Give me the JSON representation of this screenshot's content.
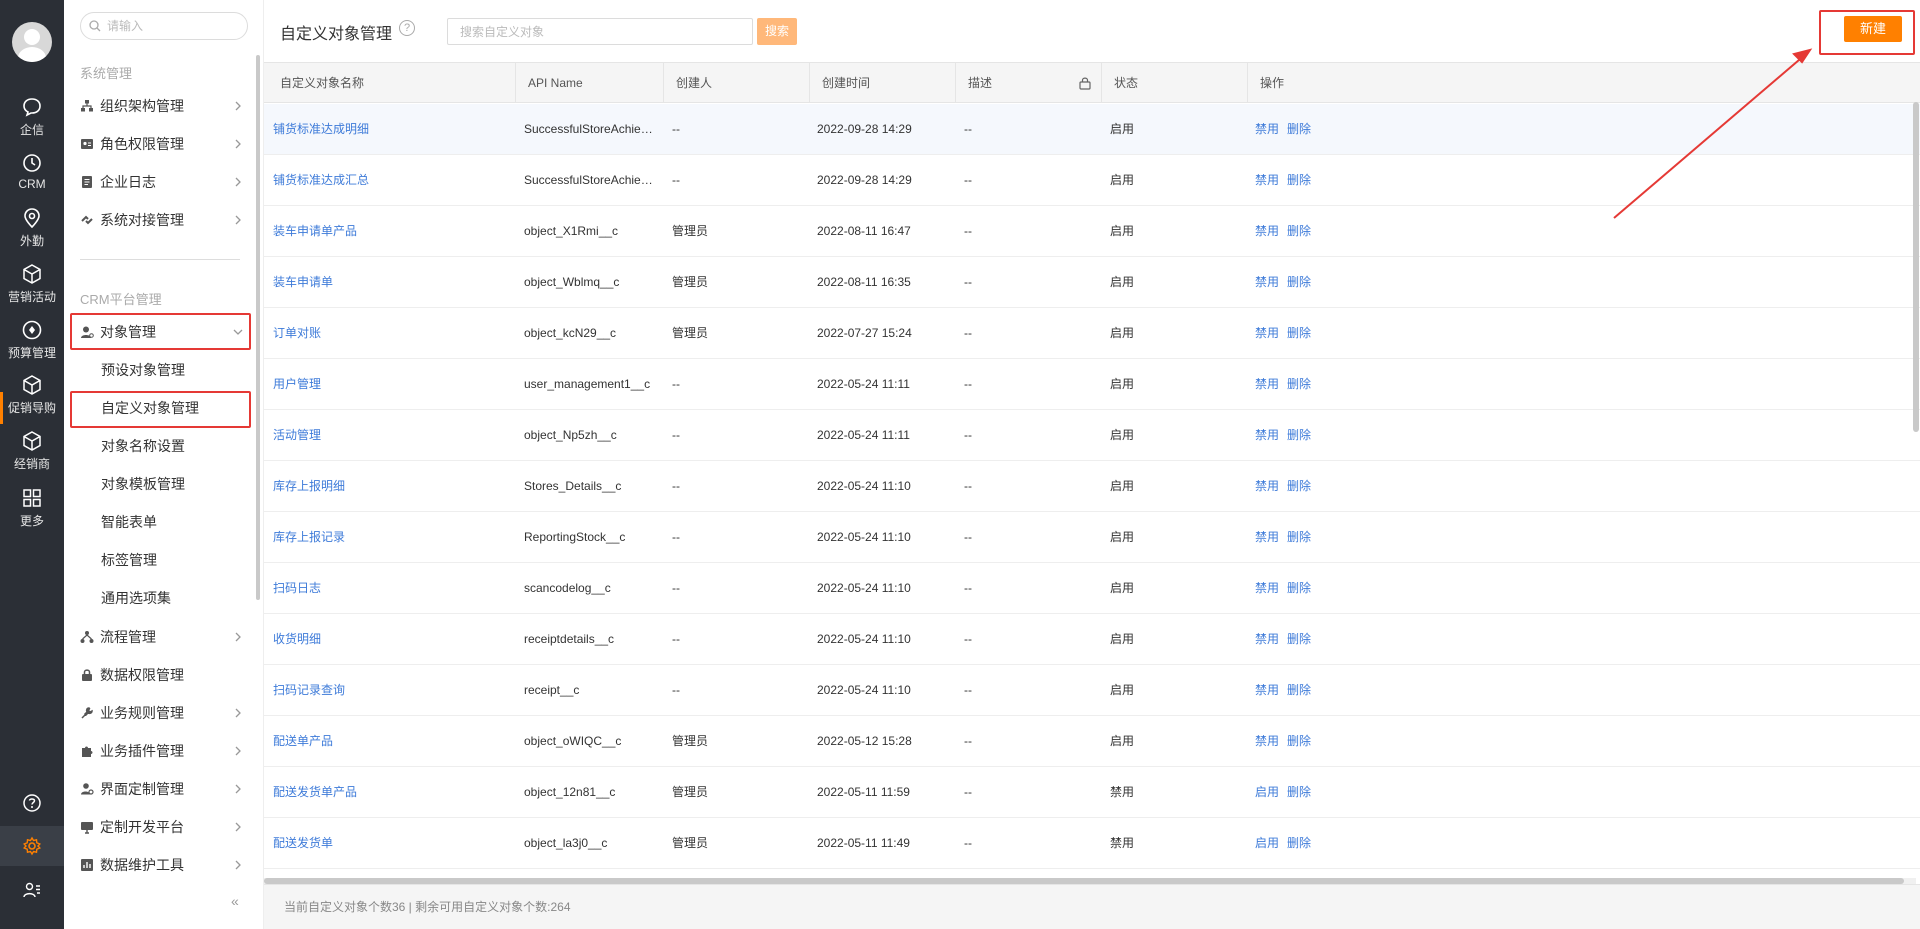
{
  "rail": {
    "items": [
      {
        "label": "企信",
        "icon": "chat-bubble-icon"
      },
      {
        "label": "CRM",
        "icon": "clock-icon"
      },
      {
        "label": "外勤",
        "icon": "location-pin-icon"
      },
      {
        "label": "营销活动",
        "icon": "cube-icon"
      },
      {
        "label": "预算管理",
        "icon": "target-icon"
      },
      {
        "label": "促销导购",
        "icon": "cube-icon"
      },
      {
        "label": "经销商",
        "icon": "cube-icon"
      },
      {
        "label": "更多",
        "icon": "grid-icon"
      }
    ],
    "bottom": [
      "help-icon",
      "settings-icon",
      "user-list-icon"
    ]
  },
  "subnav": {
    "search_placeholder": "请输入",
    "group_system": "系统管理",
    "system_items": [
      "组织架构管理",
      "角色权限管理",
      "企业日志",
      "系统对接管理"
    ],
    "group_crm": "CRM平台管理",
    "object_mgmt": "对象管理",
    "object_sub": [
      "预设对象管理",
      "自定义对象管理",
      "对象名称设置",
      "对象模板管理",
      "智能表单",
      "标签管理",
      "通用选项集"
    ],
    "crm_items": [
      "流程管理",
      "数据权限管理",
      "业务规则管理",
      "业务插件管理",
      "界面定制管理",
      "定制开发平台",
      "数据维护工具"
    ],
    "collapse_label": "«"
  },
  "header": {
    "title": "自定义对象管理",
    "help": "?",
    "search_placeholder": "搜索自定义对象",
    "search_label": "搜索",
    "new_label": "新建"
  },
  "table": {
    "columns": [
      "自定义对象名称",
      "API Name",
      "创建人",
      "创建时间",
      "描述",
      "状态",
      "操作"
    ],
    "rows": [
      {
        "name": "铺货标准达成明细",
        "api": "SuccessfulStoreAchie…",
        "creator": "--",
        "time": "2022-09-28 14:29",
        "desc": "--",
        "status": "启用",
        "op1": "禁用",
        "op2": "删除"
      },
      {
        "name": "铺货标准达成汇总",
        "api": "SuccessfulStoreAchie…",
        "creator": "--",
        "time": "2022-09-28 14:29",
        "desc": "--",
        "status": "启用",
        "op1": "禁用",
        "op2": "删除"
      },
      {
        "name": "装车申请单产品",
        "api": "object_X1Rmi__c",
        "creator": "管理员",
        "time": "2022-08-11 16:47",
        "desc": "--",
        "status": "启用",
        "op1": "禁用",
        "op2": "删除"
      },
      {
        "name": "装车申请单",
        "api": "object_Wblmq__c",
        "creator": "管理员",
        "time": "2022-08-11 16:35",
        "desc": "--",
        "status": "启用",
        "op1": "禁用",
        "op2": "删除"
      },
      {
        "name": "订单对账",
        "api": "object_kcN29__c",
        "creator": "管理员",
        "time": "2022-07-27 15:24",
        "desc": "--",
        "status": "启用",
        "op1": "禁用",
        "op2": "删除"
      },
      {
        "name": "用户管理",
        "api": "user_management1__c",
        "creator": "--",
        "time": "2022-05-24 11:11",
        "desc": "--",
        "status": "启用",
        "op1": "禁用",
        "op2": "删除"
      },
      {
        "name": "活动管理",
        "api": "object_Np5zh__c",
        "creator": "--",
        "time": "2022-05-24 11:11",
        "desc": "--",
        "status": "启用",
        "op1": "禁用",
        "op2": "删除"
      },
      {
        "name": "库存上报明细",
        "api": "Stores_Details__c",
        "creator": "--",
        "time": "2022-05-24 11:10",
        "desc": "--",
        "status": "启用",
        "op1": "禁用",
        "op2": "删除"
      },
      {
        "name": "库存上报记录",
        "api": "ReportingStock__c",
        "creator": "--",
        "time": "2022-05-24 11:10",
        "desc": "--",
        "status": "启用",
        "op1": "禁用",
        "op2": "删除"
      },
      {
        "name": "扫码日志",
        "api": "scancodelog__c",
        "creator": "--",
        "time": "2022-05-24 11:10",
        "desc": "--",
        "status": "启用",
        "op1": "禁用",
        "op2": "删除"
      },
      {
        "name": "收货明细",
        "api": "receiptdetails__c",
        "creator": "--",
        "time": "2022-05-24 11:10",
        "desc": "--",
        "status": "启用",
        "op1": "禁用",
        "op2": "删除"
      },
      {
        "name": "扫码记录查询",
        "api": "receipt__c",
        "creator": "--",
        "time": "2022-05-24 11:10",
        "desc": "--",
        "status": "启用",
        "op1": "禁用",
        "op2": "删除"
      },
      {
        "name": "配送单产品",
        "api": "object_oWIQC__c",
        "creator": "管理员",
        "time": "2022-05-12 15:28",
        "desc": "--",
        "status": "启用",
        "op1": "禁用",
        "op2": "删除"
      },
      {
        "name": "配送发货单产品",
        "api": "object_12n81__c",
        "creator": "管理员",
        "time": "2022-05-11 11:59",
        "desc": "--",
        "status": "禁用",
        "op1": "启用",
        "op2": "删除"
      },
      {
        "name": "配送发货单",
        "api": "object_la3j0__c",
        "creator": "管理员",
        "time": "2022-05-11 11:49",
        "desc": "--",
        "status": "禁用",
        "op1": "启用",
        "op2": "删除"
      }
    ]
  },
  "footer": {
    "text": "当前自定义对象个数36 | 剩余可用自定义对象个数:264"
  },
  "colors": {
    "accent": "#ff8000",
    "link": "#3e7bd9",
    "rail_bg": "#2b2f36",
    "highlight": "#e53935"
  }
}
